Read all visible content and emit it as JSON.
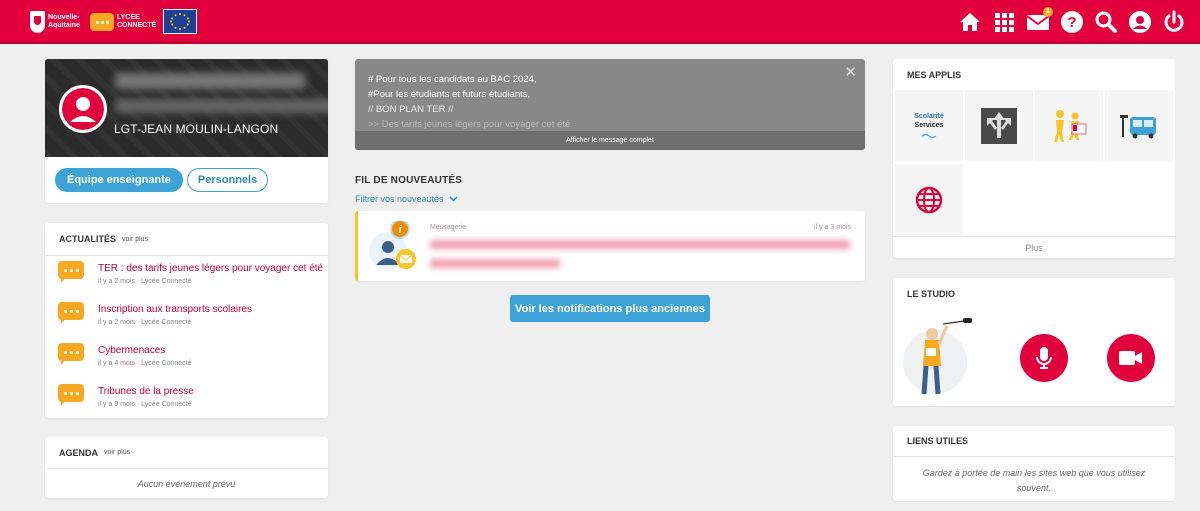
{
  "header": {
    "logo_region_text": "Nouvelle-Aquitaine",
    "logo_app_text": "LYCÉE CONNECTÉ",
    "mail_badge": "1",
    "icons": [
      "home-icon",
      "apps-grid-icon",
      "mail-icon",
      "help-icon",
      "search-icon",
      "account-icon",
      "power-icon"
    ]
  },
  "profile": {
    "school": "LGT-JEAN MOULIN-LANGON",
    "btn_teachers": "Équipe enseignante",
    "btn_staff": "Personnels"
  },
  "news": {
    "title": "ACTUALITÉS",
    "more": "voir plus",
    "items": [
      {
        "title": "TER : des tarifs jeunes légers pour voyager cet été",
        "meta": "il y a 2 mois · Lycée Connecté"
      },
      {
        "title": "Inscription aux transports scolaires",
        "meta": "il y a 2 mois · Lycée Connecté"
      },
      {
        "title": "Cybermenaces",
        "meta": "il y a 4 mois · Lycée Connecté"
      },
      {
        "title": "Tribunes de la presse",
        "meta": "il y a 9 mois · Lycée Connecté"
      }
    ]
  },
  "agenda": {
    "title": "AGENDA",
    "more": "voir plus",
    "empty": "Aucun événement prévu"
  },
  "message": {
    "line1": "# Pour tous les candidats au BAC 2024,",
    "line2": "#Pour les étudiants et futurs étudiants,",
    "line3": "// BON PLAN TER //",
    "line4": ">> Des tarifs jeunes légers pour voyager cet été",
    "show_full": "Afficher le message complet"
  },
  "feed": {
    "title": "FIL DE NOUVEAUTÉS",
    "filter": "Filtrer vos nouveautés",
    "item_label": "Messagerie",
    "item_when": "il y a 3 mois",
    "older_button": "Voir les notifications plus anciennes"
  },
  "apps": {
    "title": "MES APPLIS",
    "scolarite_line1": "Scolarité",
    "scolarite_line2": "Services",
    "plus": "Plus"
  },
  "studio": {
    "title": "LE STUDIO"
  },
  "links": {
    "title": "LIENS UTILES",
    "text": "Gardez à portée de main les sites web que vous utilisez souvent."
  },
  "colors": {
    "brand_red": "#e2003c",
    "accent_blue": "#3da3d6",
    "orange": "#f7a823"
  }
}
